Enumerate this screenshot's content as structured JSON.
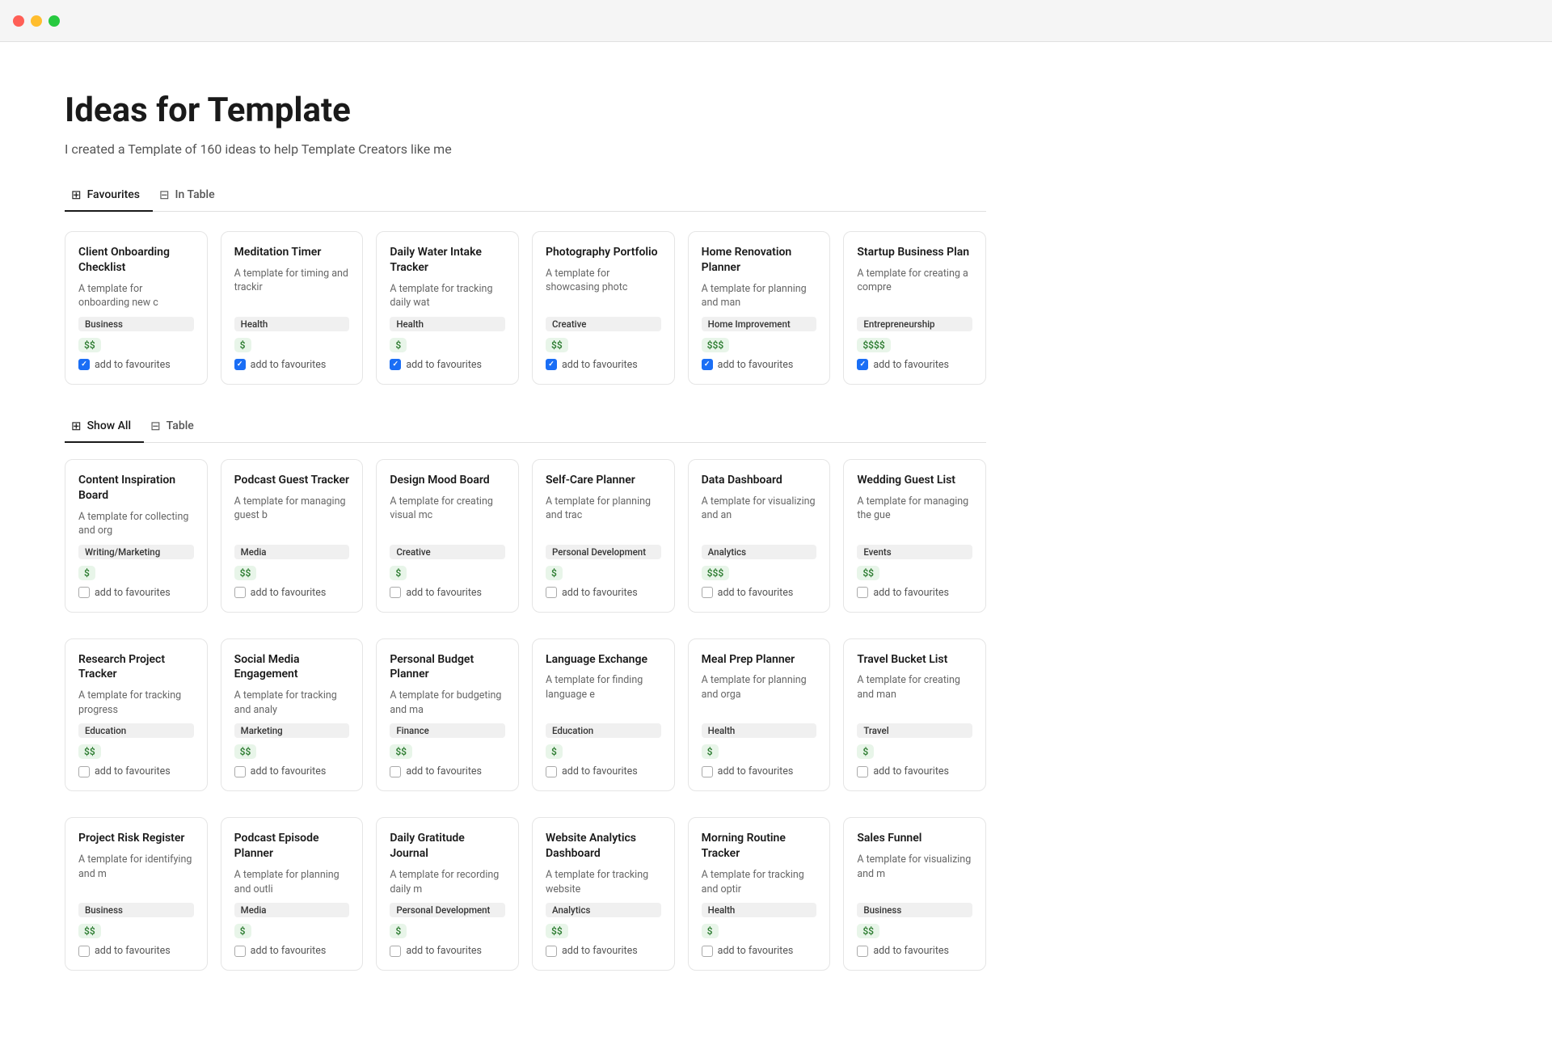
{
  "window": {
    "title": "Ideas for Template"
  },
  "page": {
    "title": "Ideas for Template",
    "subtitle": "I created a Template of 160 ideas to help Template Creators like me"
  },
  "favourites_tabs": [
    {
      "id": "favourites",
      "label": "Favourites",
      "icon": "⊞",
      "active": true
    },
    {
      "id": "in-table",
      "label": "In Table",
      "icon": "⊟",
      "active": false
    }
  ],
  "showall_tabs": [
    {
      "id": "show-all",
      "label": "Show All",
      "icon": "⊞",
      "active": true
    },
    {
      "id": "table",
      "label": "Table",
      "icon": "⊟",
      "active": false
    }
  ],
  "favourites_cards": [
    {
      "title": "Client Onboarding Checklist",
      "desc": "A template for onboarding new c",
      "tag": "Business",
      "price": "$$",
      "favourite": true
    },
    {
      "title": "Meditation Timer",
      "desc": "A template for timing and trackir",
      "tag": "Health",
      "price": "$",
      "favourite": true
    },
    {
      "title": "Daily Water Intake Tracker",
      "desc": "A template for tracking daily wat",
      "tag": "Health",
      "price": "$",
      "favourite": true
    },
    {
      "title": "Photography Portfolio",
      "desc": "A template for showcasing photc",
      "tag": "Creative",
      "price": "$$",
      "favourite": true
    },
    {
      "title": "Home Renovation Planner",
      "desc": "A template for planning and man",
      "tag": "Home Improvement",
      "price": "$$$",
      "favourite": true
    },
    {
      "title": "Startup Business Plan",
      "desc": "A template for creating a compre",
      "tag": "Entrepreneurship",
      "price": "$$$$",
      "favourite": true
    }
  ],
  "showall_row1": [
    {
      "title": "Content Inspiration Board",
      "desc": "A template for collecting and org",
      "tag": "Writing/Marketing",
      "price": "$",
      "favourite": false
    },
    {
      "title": "Podcast Guest Tracker",
      "desc": "A template for managing guest b",
      "tag": "Media",
      "price": "$$",
      "favourite": false
    },
    {
      "title": "Design Mood Board",
      "desc": "A template for creating visual mc",
      "tag": "Creative",
      "price": "$",
      "favourite": false
    },
    {
      "title": "Self-Care Planner",
      "desc": "A template for planning and trac",
      "tag": "Personal Development",
      "price": "$",
      "favourite": false
    },
    {
      "title": "Data Dashboard",
      "desc": "A template for visualizing and an",
      "tag": "Analytics",
      "price": "$$$",
      "favourite": false
    },
    {
      "title": "Wedding Guest List",
      "desc": "A template for managing the gue",
      "tag": "Events",
      "price": "$$",
      "favourite": false
    }
  ],
  "showall_row2": [
    {
      "title": "Research Project Tracker",
      "desc": "A template for tracking progress",
      "tag": "Education",
      "price": "$$",
      "favourite": false
    },
    {
      "title": "Social Media Engagement",
      "desc": "A template for tracking and analy",
      "tag": "Marketing",
      "price": "$$",
      "favourite": false
    },
    {
      "title": "Personal Budget Planner",
      "desc": "A template for budgeting and ma",
      "tag": "Finance",
      "price": "$$",
      "favourite": false
    },
    {
      "title": "Language Exchange",
      "desc": "A template for finding language e",
      "tag": "Education",
      "price": "$",
      "favourite": false
    },
    {
      "title": "Meal Prep Planner",
      "desc": "A template for planning and orga",
      "tag": "Health",
      "price": "$",
      "favourite": false
    },
    {
      "title": "Travel Bucket List",
      "desc": "A template for creating and man",
      "tag": "Travel",
      "price": "$",
      "favourite": false
    }
  ],
  "showall_row3": [
    {
      "title": "Project Risk Register",
      "desc": "A template for identifying and m",
      "tag": "Business",
      "price": "$$",
      "favourite": false
    },
    {
      "title": "Podcast Episode Planner",
      "desc": "A template for planning and outli",
      "tag": "Media",
      "price": "$",
      "favourite": false
    },
    {
      "title": "Daily Gratitude Journal",
      "desc": "A template for recording daily m",
      "tag": "Personal Development",
      "price": "$",
      "favourite": false
    },
    {
      "title": "Website Analytics Dashboard",
      "desc": "A template for tracking website",
      "tag": "Analytics",
      "price": "$$",
      "favourite": false
    },
    {
      "title": "Morning Routine Tracker",
      "desc": "A template for tracking and optir",
      "tag": "Health",
      "price": "$",
      "favourite": false
    },
    {
      "title": "Sales Funnel",
      "desc": "A template for visualizing and m",
      "tag": "Business",
      "price": "$$",
      "favourite": false
    }
  ]
}
